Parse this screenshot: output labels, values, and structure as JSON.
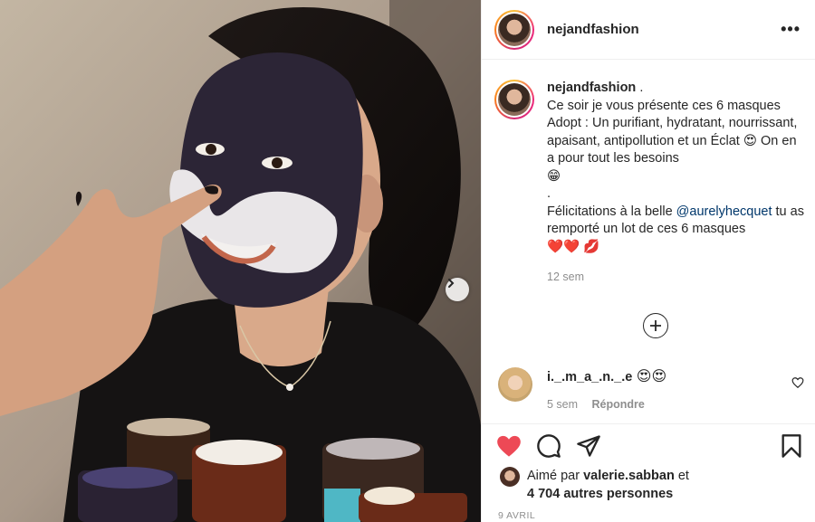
{
  "post": {
    "username": "nejandfashion",
    "more_icon": "more-horizontal-icon"
  },
  "caption": {
    "username": "nejandfashion",
    "line1_suffix": " .",
    "text1": "Ce soir je vous présente ces 6 masques Adopt : Un purifiant, hydratant, nourrissant, apaisant, antipollution et un Éclat",
    "emoji_heart_eyes": "😍",
    "text2": " On en a pour tout les besoins",
    "emoji_grin": "😁",
    "dot": ".",
    "text3": "Félicitations à la belle ",
    "mention": "@aurelyhecquet",
    "text4": " tu as remporté un lot de ces 6 masques",
    "emoji_hearts": "❤️❤️",
    "emoji_kiss": "💋",
    "time": "12 sem"
  },
  "comment": {
    "username": "i._.m_a_.n._.e",
    "emojis": "😍😍",
    "time": "5 sem",
    "reply_label": "Répondre"
  },
  "likes": {
    "prefix": "Aimé par ",
    "user": "valerie.sabban",
    "middle": " et",
    "others": "4 704 autres personnes"
  },
  "date": "9 AVRIL",
  "colors": {
    "like_red": "#ed4956",
    "link_blue": "#00376b",
    "muted_gray": "#8e8e8e"
  }
}
